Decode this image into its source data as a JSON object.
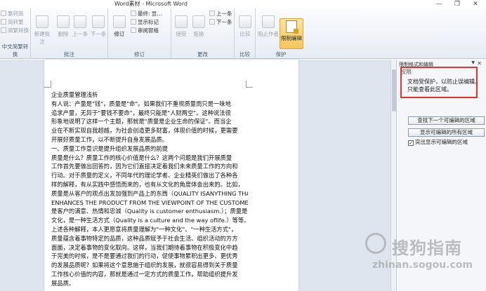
{
  "window": {
    "title": "Word素材 - Microsoft Word",
    "minimize": "—",
    "restore": "❐",
    "close": "✕"
  },
  "ribbon": {
    "convert": {
      "items": [
        "繁转简",
        "简转繁",
        "简繁转换"
      ],
      "group_label": "中文简繁转换"
    },
    "comments": {
      "buttons": [
        "新建批注",
        "删除",
        "上一条",
        "下一条"
      ],
      "group_label": "批注"
    },
    "tracking": {
      "track_button": "修订",
      "options": [
        "最终: 显...",
        "显示标记",
        "审阅窗格"
      ],
      "group_label": "修订"
    },
    "changes": {
      "buttons": [
        "接受",
        "拒绝"
      ],
      "prev": "上一条",
      "next": "下一条",
      "group_label": "更改"
    },
    "compare": {
      "button": "比较",
      "group_label": "比较"
    },
    "protect": {
      "block_authors": "阻止作者",
      "restrict_editing": "限制编辑",
      "group_label": "保护"
    }
  },
  "document": {
    "paragraphs": [
      "企业质量管理浅析",
      "有人说：产量是\"钱\"，质量是\"命\"。如果我们不重视质量而只是一味地",
      "追求产量，无异于\"要钱不要命\"，最终只能是\"人财两空\"。这种说法很",
      "形象地说明了这样一个主题，那就是\"质量是企业生命的保证\"。而当企",
      "业在不断实现自我超越，为社会创造更多财富，体现价值的时候，更需要",
      "开展好质量工作，以不断提升自身发展品质。",
      "一、质量工作意识是提升组织发展品质的前提",
      "质量是什么？质量工作的核心价值是什么？这两个问题是我们开展质量",
      "工作首先要做出回答的，因为它们直接决定着我们未来质量工作的方向和",
      "行动。对于质量的定义，不同年代的理论学者、企业精英们做出了各种各",
      "样的解释，有从实践中感悟而来的，也有从文化的角度体会出来的。比如，",
      "质量是从客户的观点出发加强到产品上的东西（QUALITY ISANYTHING THAT",
      "ENHANCES THE PRODUCT FROM THE VIEWPOINT OF THE CUSTOMER.）；质量",
      "是客户的满意、热情和忠诚（Quality is customer enthusiasm.）；质量是一种",
      "文化，是一种生活方式（Quality is a culture and the way oflife.）等等。对于",
      "上述各种解释，本人更愿意将质量理解为\"一种文化\"、\"一种生活方式\"，",
      "质量蕴含着事物特定的品质，这种品质赋予于社会生活、组织活动的方方",
      "面面，决定着事物的变化取向。这样，当我们期待着事物在积极变化中趋",
      "于完美的时候，是不是要通过我们的行动，促使事物累积出更多、更优秀",
      "的发展品质呢？如果将这个意思施于组织的发展，就很容易得到关于质量",
      "工作核心价值的内容，那就是通过一定方式的质量工作，帮助组织提升发",
      "展品质。"
    ]
  },
  "pane": {
    "title": "限制格式和编辑",
    "dropdown": "▼",
    "close": "✕",
    "section": "权限",
    "protected_text_line1": "文档受保护，以防止误编辑。",
    "protected_text_line2": "只能查看此区域。",
    "find_next_button": "查找下一个可编辑的区域",
    "show_all_button": "显示可编辑的所有区域",
    "highlight_checkbox_label": "突出显示可编辑的区域",
    "highlight_checked": true
  },
  "watermark": {
    "brand": "搜狗指南",
    "url": "zhinan.sogou.com"
  },
  "colors": {
    "highlight_box": "#e8322f",
    "restrict_button": "#f8c55a"
  }
}
